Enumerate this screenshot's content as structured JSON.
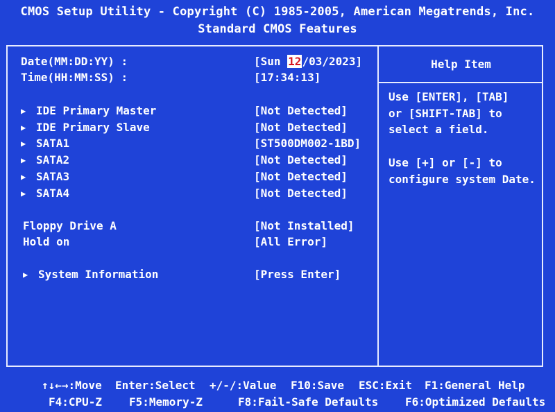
{
  "header": {
    "line1": "CMOS Setup Utility - Copyright (C) 1985-2005, American Megatrends, Inc.",
    "line2": "Standard CMOS Features"
  },
  "settings": {
    "date": {
      "label": "Date(MM:DD:YY) :",
      "value_prefix": "[Sun ",
      "value_highlight": "12",
      "value_suffix": "/03/2023]"
    },
    "time": {
      "label": "Time(HH:MM:SS) :",
      "value": "[17:34:13]"
    },
    "ide_primary_master": {
      "label": "IDE Primary Master",
      "value": "[Not Detected]"
    },
    "ide_primary_slave": {
      "label": "IDE Primary Slave",
      "value": "[Not Detected]"
    },
    "sata1": {
      "label": "SATA1",
      "value": "[ST500DM002-1BD]"
    },
    "sata2": {
      "label": "SATA2",
      "value": "[Not Detected]"
    },
    "sata3": {
      "label": "SATA3",
      "value": "[Not Detected]"
    },
    "sata4": {
      "label": "SATA4",
      "value": "[Not Detected]"
    },
    "floppy": {
      "label": "Floppy Drive A",
      "value": "[Not Installed]"
    },
    "hold_on": {
      "label": "Hold on",
      "value": "[All Error]"
    },
    "system_info": {
      "label": "System Information",
      "value": "[Press Enter]"
    }
  },
  "submenu_arrow": "▶",
  "help": {
    "title": "Help Item",
    "line1": "Use [ENTER], [TAB]",
    "line2": "or [SHIFT-TAB] to",
    "line3": "select a field.",
    "line4": "Use [+] or [-] to",
    "line5": "configure system Date."
  },
  "footer": {
    "move": "↑↓←→:Move",
    "enter": "Enter:Select",
    "value": "+/-/:Value",
    "f10": "F10:Save",
    "esc": "ESC:Exit",
    "f1": "F1:General Help",
    "f4": "F4:CPU-Z",
    "f5": "F5:Memory-Z",
    "f8": "F8:Fail-Safe Defaults",
    "f6": "F6:Optimized Defaults"
  },
  "colors": {
    "background": "#1f43d8",
    "text": "#ffffff",
    "highlight_text": "#d8141f",
    "highlight_bg": "#ffffff"
  }
}
